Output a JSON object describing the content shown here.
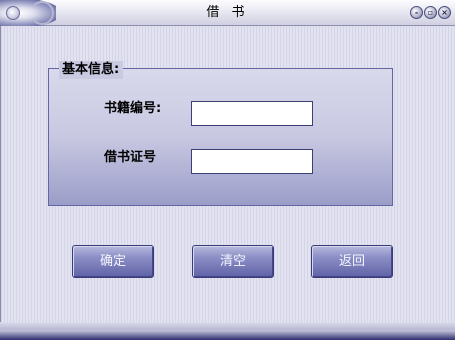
{
  "window": {
    "title": "借 书",
    "controls": {
      "minimize": "-",
      "maximize": "▫",
      "close": "×"
    }
  },
  "form": {
    "group_title": "基本信息:",
    "fields": [
      {
        "label": "书籍编号:",
        "value": "",
        "placeholder": ""
      },
      {
        "label": "借书证号",
        "value": "",
        "placeholder": ""
      }
    ],
    "buttons": {
      "confirm": "确定",
      "clear": "清空",
      "back": "返回"
    }
  },
  "colors": {
    "button_gradient_top": "#b7b9dd",
    "button_gradient_bottom": "#5f62a6",
    "panel_background": "#dcdcec"
  }
}
